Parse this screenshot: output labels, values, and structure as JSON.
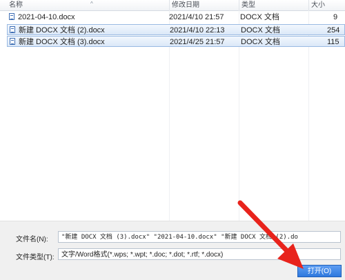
{
  "columns": {
    "name": "名称",
    "modified": "修改日期",
    "type": "类型",
    "size": "大小"
  },
  "files": [
    {
      "name": "2021-04-10.docx",
      "modified": "2021/4/10 21:57",
      "type": "DOCX 文档",
      "size": "9"
    },
    {
      "name": "新建 DOCX 文档 (2).docx",
      "modified": "2021/4/10 22:13",
      "type": "DOCX 文档",
      "size": "254"
    },
    {
      "name": "新建 DOCX 文档 (3).docx",
      "modified": "2021/4/25 21:57",
      "type": "DOCX 文档",
      "size": "115"
    }
  ],
  "filename_field": {
    "label": "文件名(N):",
    "value": "\"新建 DOCX 文档 (3).docx\" \"2021-04-10.docx\" \"新建 DOCX 文档 (2).do"
  },
  "filetype_field": {
    "label": "文件类型(T):",
    "value": "文字/Word格式(*.wps; *.wpt; *.doc; *.dot; *.rtf; *.docx)"
  },
  "open_button": {
    "label": "打开(O)"
  },
  "colors": {
    "selection": "#dbe8f8",
    "selection_border": "#99b9e2",
    "button": "#3b82e6",
    "arrow": "#e8231c"
  }
}
